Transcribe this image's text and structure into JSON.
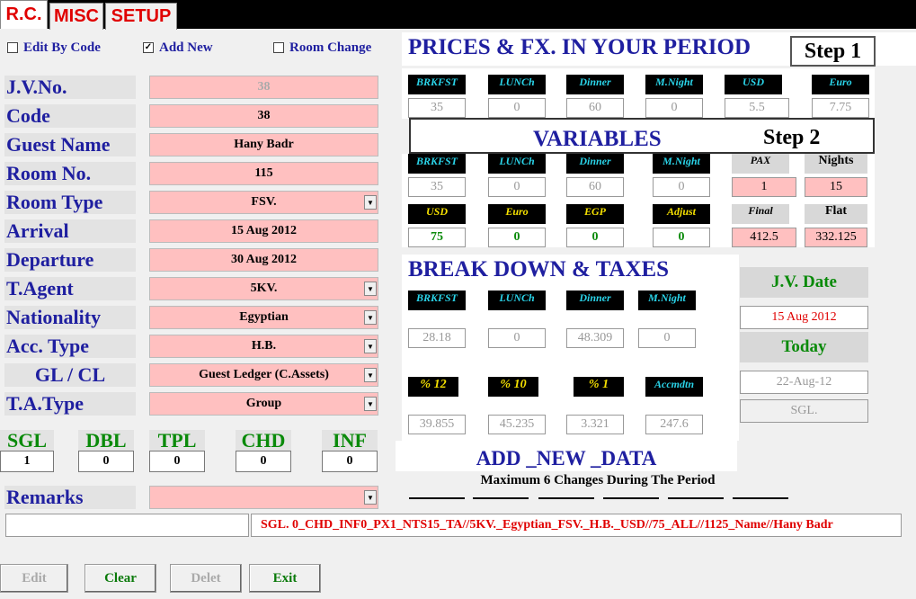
{
  "tabs": [
    "R.C.",
    "MISC",
    "SETUP"
  ],
  "checkboxes": [
    {
      "label": "Edit By Code",
      "checked": false
    },
    {
      "label": "Add New",
      "checked": true
    },
    {
      "label": "Room Change",
      "checked": false
    }
  ],
  "fields": [
    {
      "label": "J.V.No.",
      "value": "38",
      "dropdown": false
    },
    {
      "label": "Code",
      "value": "38",
      "dropdown": false
    },
    {
      "label": "Guest Name",
      "value": "Hany Badr",
      "dropdown": false
    },
    {
      "label": "Room No.",
      "value": "115",
      "dropdown": false
    },
    {
      "label": "Room Type",
      "value": "FSV.",
      "dropdown": true
    },
    {
      "label": "Arrival",
      "value": "15 Aug 2012",
      "dropdown": false
    },
    {
      "label": "Departure",
      "value": "30 Aug 2012",
      "dropdown": false
    },
    {
      "label": "T.Agent",
      "value": "5KV.",
      "dropdown": true
    },
    {
      "label": "Nationality",
      "value": "Egyptian",
      "dropdown": true
    },
    {
      "label": "Acc. Type",
      "value": "H.B.",
      "dropdown": true
    },
    {
      "label": "GL / CL",
      "value": "Guest Ledger (C.Assets)",
      "dropdown": true
    },
    {
      "label": "T.A.Type",
      "value": "Group",
      "dropdown": true
    }
  ],
  "counts": [
    {
      "label": "SGL",
      "value": "1"
    },
    {
      "label": "DBL",
      "value": "0"
    },
    {
      "label": "TPL",
      "value": "0"
    },
    {
      "label": "CHD",
      "value": "0"
    },
    {
      "label": "INF",
      "value": "0"
    }
  ],
  "remarks": {
    "label": "Remarks",
    "value": ""
  },
  "summary_text": "SGL. 0_CHD_INF0_PX1_NTS15_TA//5KV._Egyptian_FSV._H.B._USD//75_ALL//1125_Name//Hany Badr",
  "prices": {
    "title": "PRICES & FX.  IN YOUR PERIOD",
    "step": "Step 1",
    "headers": [
      "BRKFST",
      "LUNCh",
      "Dinner",
      "M.Night",
      "USD",
      "Euro"
    ],
    "values": [
      "35",
      "0",
      "60",
      "0",
      "5.5",
      "7.75"
    ]
  },
  "variables": {
    "title": "VARIABLES",
    "step": "Step 2",
    "headers": [
      "BRKFST",
      "LUNCh",
      "Dinner",
      "M.Night"
    ],
    "values": [
      "35",
      "0",
      "60",
      "0"
    ],
    "pax_label": "PAX",
    "pax_value": "1",
    "nights_label": "Nights",
    "nights_value": "15",
    "fx_headers": [
      "USD",
      "Euro",
      "EGP",
      "Adjust"
    ],
    "fx_values": [
      "75",
      "0",
      "0",
      "0"
    ],
    "final_label": "Final",
    "final_value": "412.5",
    "flat_label": "Flat",
    "flat_value": "332.125"
  },
  "breakdown": {
    "title": "BREAK DOWN & TAXES",
    "headers": [
      "BRKFST",
      "LUNCh",
      "Dinner",
      "M.Night"
    ],
    "values": [
      "28.18",
      "0",
      "48.309",
      "0"
    ],
    "tax_headers": [
      "% 12",
      "% 10",
      "% 1",
      "Accmdtn"
    ],
    "tax_values": [
      "39.855",
      "45.235",
      "3.321",
      "247.6"
    ]
  },
  "jv_date": {
    "label": "J.V. Date",
    "value": "15 Aug 2012"
  },
  "today": {
    "label": "Today",
    "value": "22-Aug-12",
    "type": "SGL."
  },
  "add_new": {
    "title": "ADD _NEW _DATA",
    "subtitle": "Maximum 6 Changes  During The Period"
  },
  "buttons": [
    {
      "label": "Edit",
      "enabled": false
    },
    {
      "label": "Clear",
      "enabled": true
    },
    {
      "label": "Delet",
      "enabled": false
    },
    {
      "label": "Exit",
      "enabled": true
    }
  ]
}
